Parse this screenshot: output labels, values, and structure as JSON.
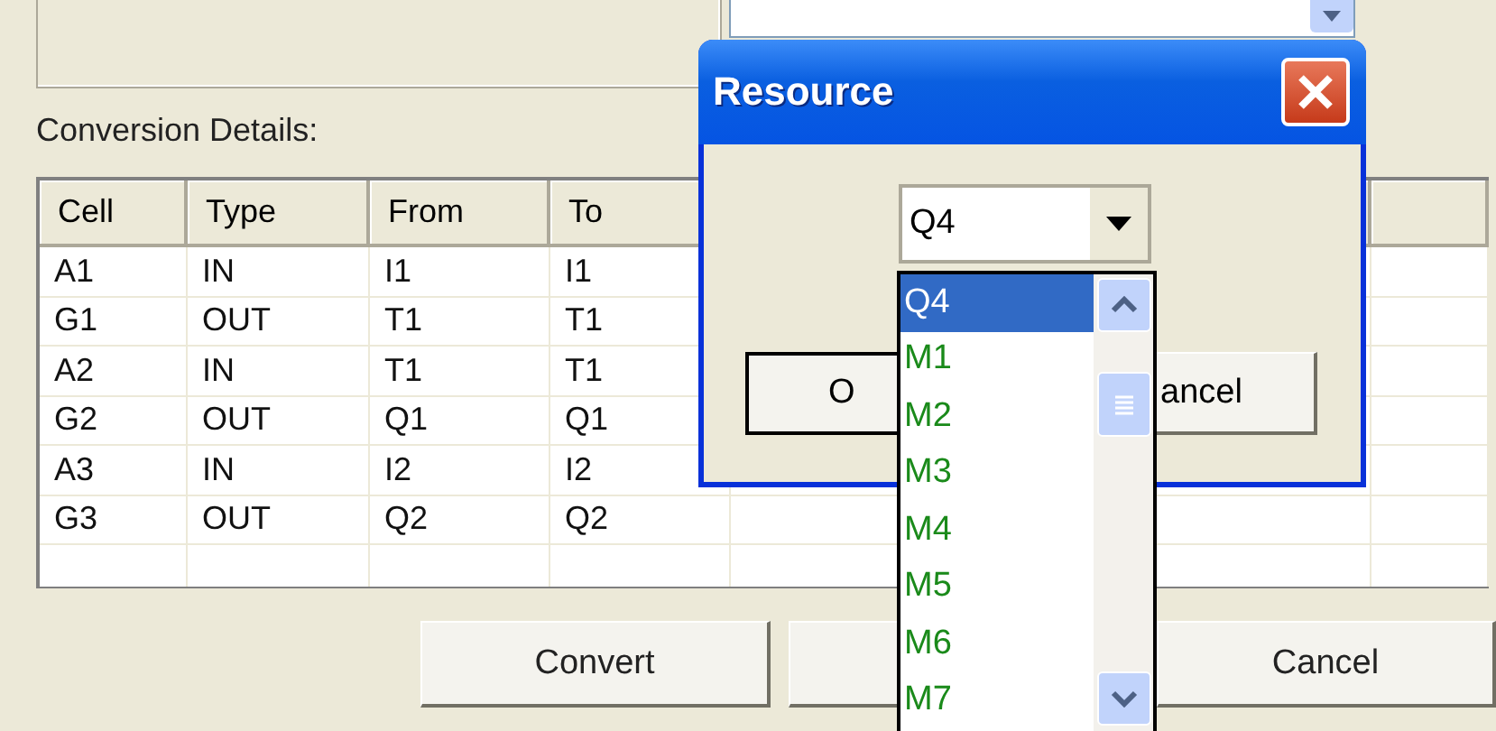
{
  "form": {
    "section_label": "Conversion Details:",
    "table": {
      "columns": [
        "Cell",
        "Type",
        "From",
        "To"
      ],
      "rows": [
        [
          "A1",
          "IN",
          "I1",
          "I1"
        ],
        [
          "G1",
          "OUT",
          "T1",
          "T1"
        ],
        [
          "A2",
          "IN",
          "T1",
          "T1"
        ],
        [
          "G2",
          "OUT",
          "Q1",
          "Q1"
        ],
        [
          "A3",
          "IN",
          "I2",
          "I2"
        ],
        [
          "G3",
          "OUT",
          "Q2",
          "Q2"
        ]
      ]
    },
    "buttons": [
      "Convert",
      "Cancel"
    ]
  },
  "dialog": {
    "title": "Resource",
    "combo": {
      "value": "Q4"
    },
    "buttons": [
      "O",
      "ancel"
    ]
  },
  "dropdown": {
    "items": [
      {
        "label": "Q4",
        "selected": true
      },
      {
        "label": "M1",
        "selected": false
      },
      {
        "label": "M2",
        "selected": false
      },
      {
        "label": "M3",
        "selected": false
      },
      {
        "label": "M4",
        "selected": false
      },
      {
        "label": "M5",
        "selected": false
      },
      {
        "label": "M6",
        "selected": false
      },
      {
        "label": "M7",
        "selected": false
      }
    ]
  }
}
